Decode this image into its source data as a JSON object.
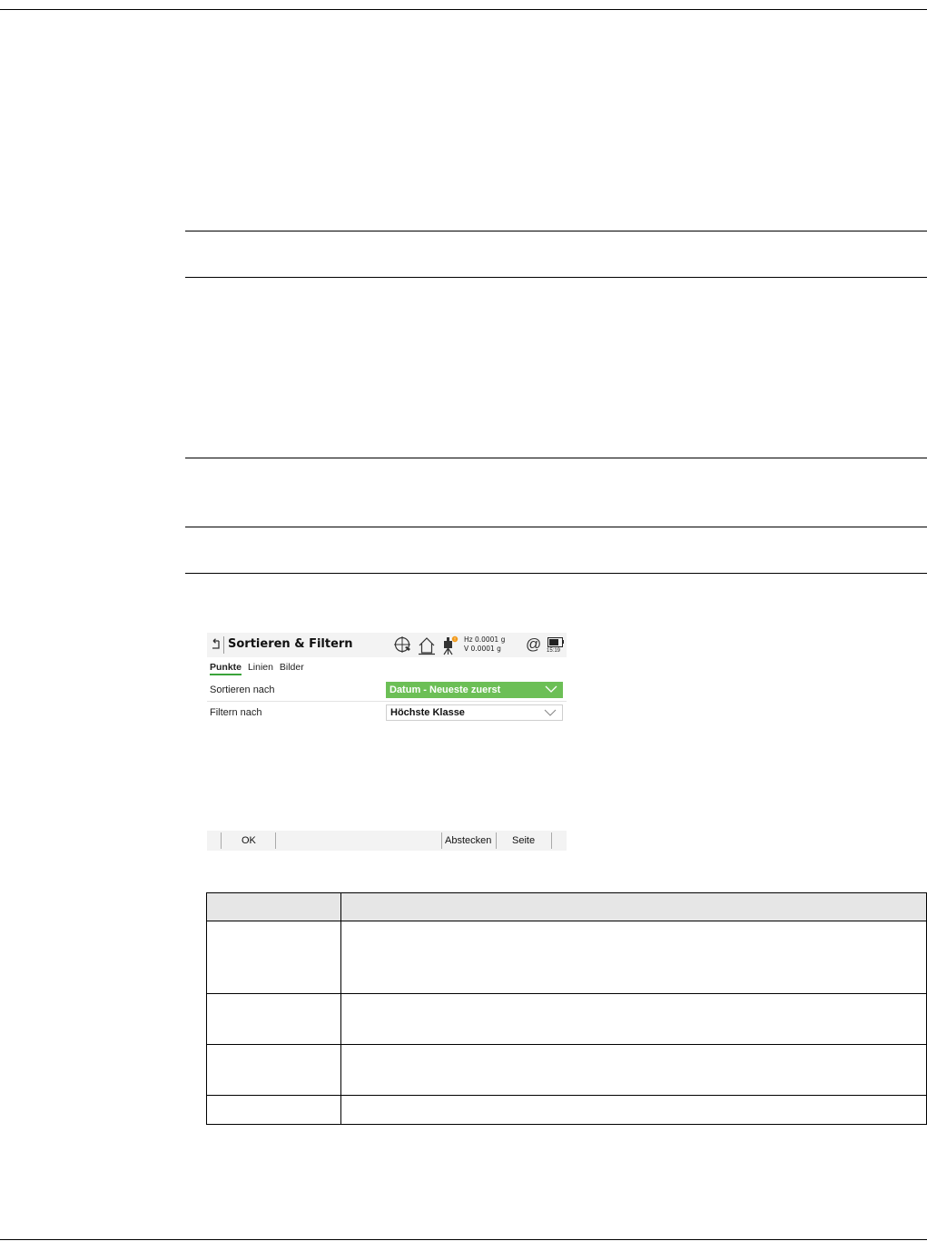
{
  "screen": {
    "title": "Sortieren & Filtern",
    "measurements": {
      "hz": "Hz 0.0001 g",
      "v": "V   0.0001 g"
    },
    "at_symbol": "@",
    "time": "15:19",
    "tabs": [
      {
        "label": "Punkte",
        "active": true
      },
      {
        "label": "Linien",
        "active": false
      },
      {
        "label": "Bilder",
        "active": false
      }
    ],
    "fields": [
      {
        "label": "Sortieren nach",
        "value": "Datum - Neueste zuerst",
        "highlighted": true
      },
      {
        "label": "Filtern nach",
        "value": "Höchste Klasse",
        "highlighted": false
      }
    ],
    "softkeys": {
      "ok": "OK",
      "stakeout": "Abstecken",
      "page": "Seite"
    },
    "colors": {
      "accent_green": "#6cbf56",
      "tab_underline": "#3aa33a",
      "notification": "#f29a1a"
    },
    "icons": [
      "back-icon",
      "target-icon",
      "home-icon",
      "instrument-icon",
      "at-icon",
      "battery-icon",
      "chevron-down-icon"
    ]
  }
}
